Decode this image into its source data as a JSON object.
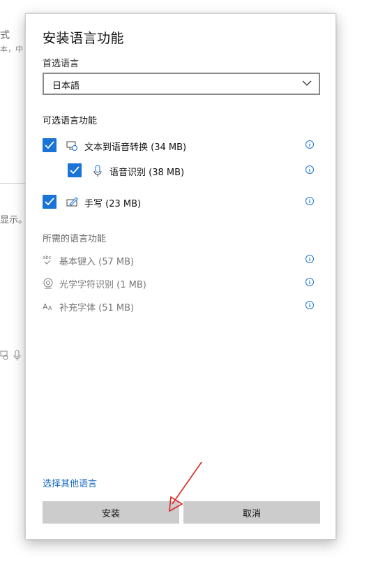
{
  "background": {
    "frag1": "式",
    "frag2": "本，中",
    "frag3": "显示。"
  },
  "dialog": {
    "title": "安装语言功能",
    "preferred_label": "首选语言",
    "preferred_value": "日本語",
    "optional_title": "可选语言功能",
    "optional_features": [
      {
        "label": "文本到语音转换 (34 MB)",
        "checked": true,
        "icon": "text-to-speech-icon"
      },
      {
        "label": "语音识别 (38 MB)",
        "checked": true,
        "icon": "microphone-icon"
      },
      {
        "label": "手写 (23 MB)",
        "checked": true,
        "icon": "handwriting-icon"
      }
    ],
    "required_title": "所需的语言功能",
    "required_features": [
      {
        "label": "基本键入 (57 MB)",
        "icon": "abc-typing-icon"
      },
      {
        "label": "光学字符识别 (1 MB)",
        "icon": "camera-ocr-icon"
      },
      {
        "label": "补充字体 (51 MB)",
        "icon": "font-aa-icon"
      }
    ],
    "other_language_link": "选择其他语言",
    "install_button": "安装",
    "cancel_button": "取消"
  },
  "colors": {
    "accent": "#1a73d6",
    "link": "#1a6bbf",
    "button_bg": "#cccccc",
    "annotation_arrow": "#e02020"
  }
}
